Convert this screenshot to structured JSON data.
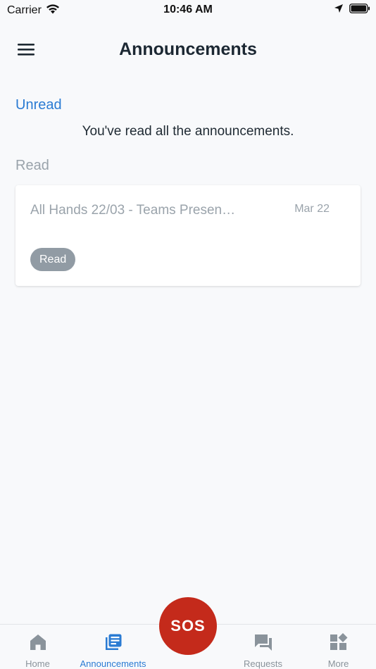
{
  "status_bar": {
    "carrier": "Carrier",
    "time": "10:46 AM"
  },
  "header": {
    "title": "Announcements"
  },
  "unread_section": {
    "label": "Unread",
    "empty_message": "You've read all the announcements."
  },
  "read_section": {
    "label": "Read",
    "items": [
      {
        "title": "All Hands 22/03 - Teams Presen…",
        "date": "Mar 22",
        "badge": "Read"
      }
    ]
  },
  "tabbar": {
    "tabs": [
      {
        "label": "Home",
        "icon": "home-icon",
        "active": false
      },
      {
        "label": "Announcements",
        "icon": "announcements-icon",
        "active": true
      },
      {
        "label": "Requests",
        "icon": "chat-icon",
        "active": false
      },
      {
        "label": "More",
        "icon": "grid-icon",
        "active": false
      }
    ],
    "sos_label": "SOS"
  },
  "colors": {
    "accent": "#2a7bd3",
    "sos": "#c42a1b",
    "muted": "#9aa3ab",
    "badge": "#919ba4"
  }
}
